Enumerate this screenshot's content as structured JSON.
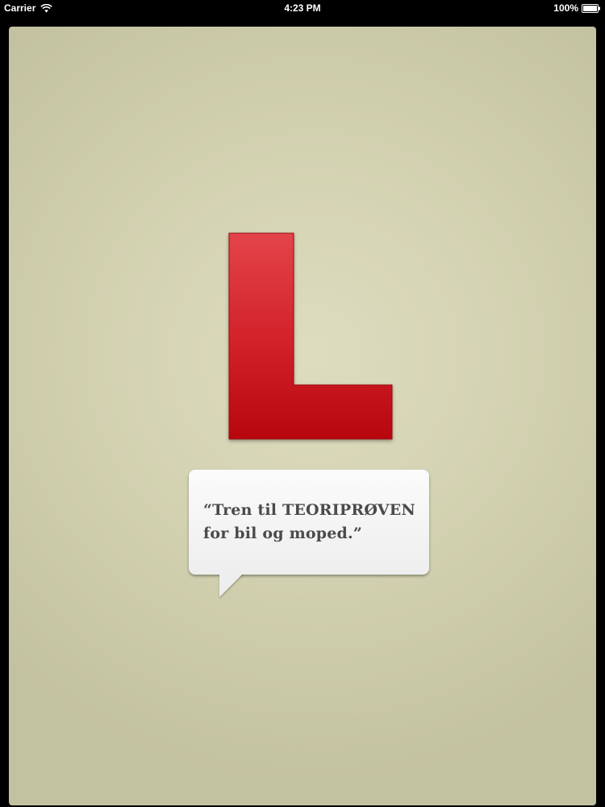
{
  "status_bar": {
    "carrier": "Carrier",
    "time": "4:23 PM",
    "battery": "100%",
    "wifi_icon": "wifi-icon",
    "battery_icon": "battery-icon"
  },
  "logo": {
    "icon": "learner-l-logo",
    "color": "#c8141c"
  },
  "bubble": {
    "line1": "“Tren til TEORIPRØVEN",
    "line2": "for bil og moped.”"
  }
}
